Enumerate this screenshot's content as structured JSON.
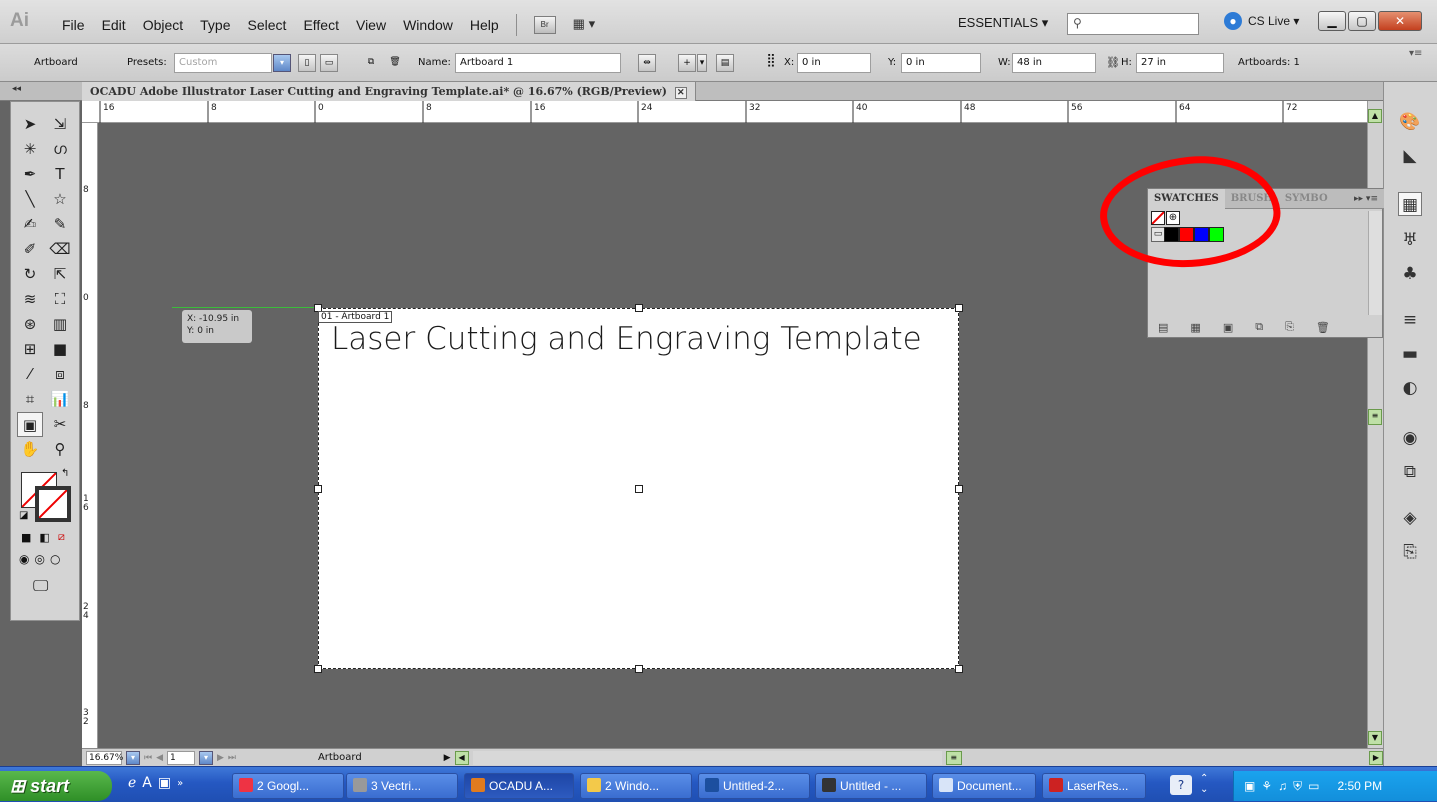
{
  "menubar": {
    "logo": "Ai",
    "items": [
      "File",
      "Edit",
      "Object",
      "Type",
      "Select",
      "Effect",
      "View",
      "Window",
      "Help"
    ],
    "br_label": "Br",
    "workspace": "ESSENTIALS ▾",
    "cslive": "CS Live ▾"
  },
  "control": {
    "artboard_label": "Artboard",
    "presets_label": "Presets:",
    "presets_value": "Custom",
    "name_label": "Name:",
    "name_value": "Artboard 1",
    "x_label": "X:",
    "x_value": "0 in",
    "y_label": "Y:",
    "y_value": "0 in",
    "w_label": "W:",
    "w_value": "48 in",
    "h_label": "H:",
    "h_value": "27 in",
    "artboards": "Artboards: 1"
  },
  "document": {
    "tab_title": "OCADU Adobe Illustrator Laser Cutting and Engraving Template.ai* @ 16.67% (RGB/Preview)",
    "artboard_label": "01 - Artboard 1",
    "artboard_text": "Laser Cutting and Engraving Template",
    "tooltip_x": "X: -10.95 in",
    "tooltip_y": "Y: 0 in"
  },
  "rulers": {
    "horizontal": [
      "16",
      "8",
      "0",
      "8",
      "16",
      "24",
      "32",
      "40",
      "48",
      "56",
      "64",
      "72"
    ],
    "vertical": [
      "8",
      "0",
      "8",
      "16",
      "24",
      "32"
    ]
  },
  "swatches": {
    "tabs": [
      "SWATCHES",
      "BRUSH",
      "SYMBO"
    ],
    "colors": [
      "#000000",
      "#ff0000",
      "#0000ff",
      "#00ff00"
    ]
  },
  "status": {
    "zoom": "16.67%",
    "page": "1",
    "mode": "Artboard"
  },
  "taskbar": {
    "start": "start",
    "buttons": [
      "2 Googl...",
      "3 Vectri...",
      "OCADU A...",
      "2 Windo...",
      "Untitled-2...",
      "Untitled - ...",
      "Document...",
      "LaserRes..."
    ],
    "clock": "2:50 PM"
  }
}
